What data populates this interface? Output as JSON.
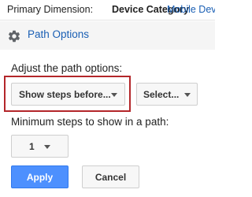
{
  "dimension_bar": {
    "label": "Primary Dimension:",
    "active": "Device Category",
    "link": "Mobile Dev"
  },
  "section": {
    "title": "Path Options",
    "icon": "gear-icon"
  },
  "adjust_label": "Adjust the path options:",
  "steps_dropdown": {
    "value": "Show steps before..."
  },
  "select_dropdown": {
    "value": "Select..."
  },
  "min_steps": {
    "label": "Minimum steps to show in a path:",
    "value": "1"
  },
  "buttons": {
    "apply": "Apply",
    "cancel": "Cancel"
  },
  "colors": {
    "accent": "#4d90fe",
    "link": "#1a5fb4",
    "highlight_frame": "#b3262a"
  }
}
